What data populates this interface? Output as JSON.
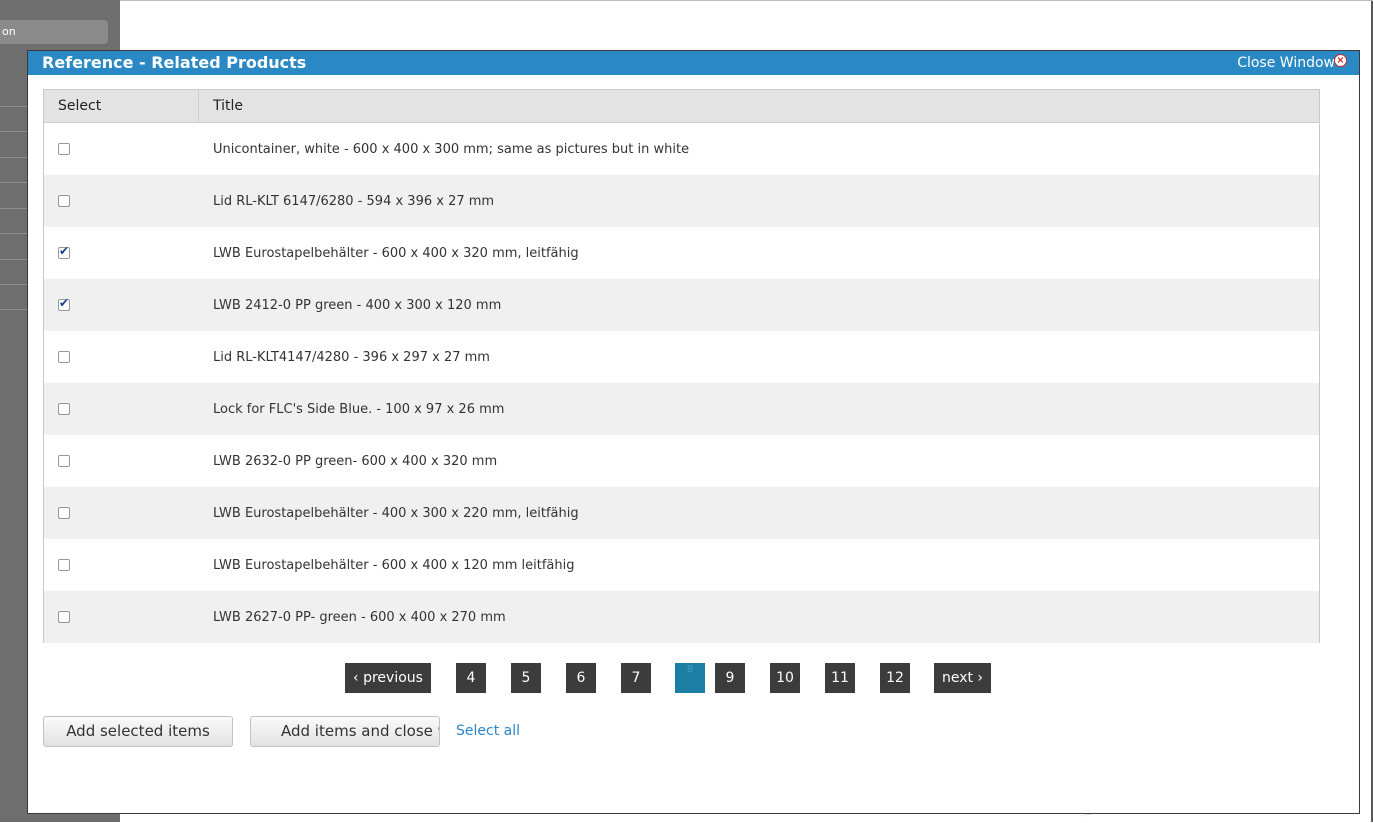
{
  "background": {
    "sidebar_button_label": "on"
  },
  "modal": {
    "title": "Reference - Related Products",
    "close_label": "Close Window",
    "close_icon": "close-circle-icon"
  },
  "table": {
    "columns": [
      "Select",
      "Title"
    ],
    "rows": [
      {
        "title": "Unicontainer, white - 600 x 400 x 300 mm; same as pictures but in white",
        "checked": false
      },
      {
        "title": "Lid RL-KLT 6147/6280 - 594 x 396 x 27 mm",
        "checked": false
      },
      {
        "title": "LWB Eurostapelbehälter - 600 x 400 x 320 mm, leitfähig",
        "checked": true
      },
      {
        "title": "LWB 2412-0 PP green - 400 x 300 x 120 mm",
        "checked": true
      },
      {
        "title": "Lid RL-KLT4147/4280 - 396 x 297 x 27 mm",
        "checked": false
      },
      {
        "title": "Lock for FLC's Side Blue. - 100 x 97 x 26 mm",
        "checked": false
      },
      {
        "title": "LWB 2632-0 PP green- 600 x 400 x 320 mm",
        "checked": false
      },
      {
        "title": "LWB Eurostapelbehälter - 400 x 300 x 220 mm, leitfähig",
        "checked": false
      },
      {
        "title": "LWB Eurostapelbehälter - 600 x 400 x 120 mm leitfähig",
        "checked": false
      },
      {
        "title": "LWB 2627-0 PP- green - 600 x 400 x 270 mm",
        "checked": false
      }
    ]
  },
  "pagination": {
    "previous_label": "‹ previous",
    "next_label": "next ›",
    "pages": [
      "4",
      "5",
      "6",
      "7",
      "8",
      "9",
      "10",
      "11",
      "12"
    ],
    "current_page": "8"
  },
  "actions": {
    "add_selected_label": "Add selected items",
    "add_and_close_label": "Add items and close window",
    "select_all_label": "Select all"
  },
  "colors": {
    "header_bg": "#2a88c4",
    "pager_bg": "#3c3c3c",
    "pager_current_bg": "#1d7ea3",
    "link": "#2b86c9"
  }
}
